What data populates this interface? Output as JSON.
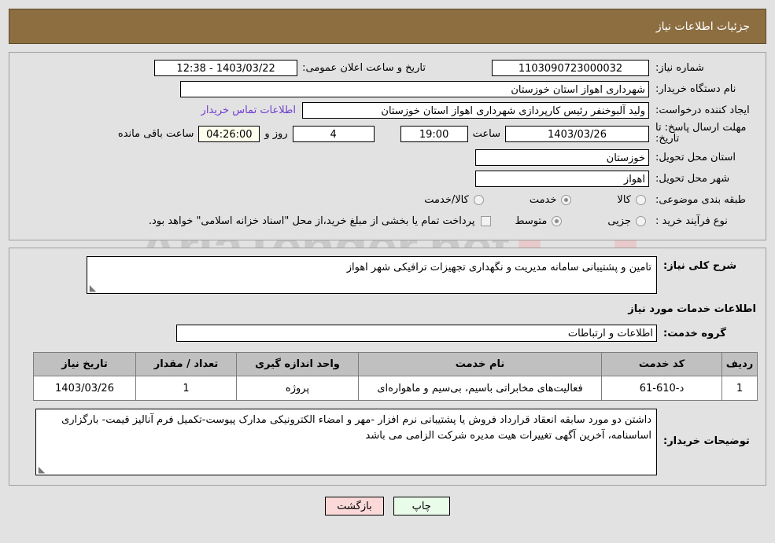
{
  "header": {
    "title": "جزئیات اطلاعات نیاز"
  },
  "form": {
    "need_number_label": "شماره نیاز:",
    "need_number_value": "1103090723000032",
    "announce_label": "تاریخ و ساعت اعلان عمومی:",
    "announce_value": "1403/03/22 - 12:38",
    "buyer_org_label": "نام دستگاه خریدار:",
    "buyer_org_value": "شهرداری اهواز استان خوزستان",
    "creator_label": "ایجاد کننده درخواست:",
    "creator_value": "ولید آلبوخنفر رئیس کارپردازی شهرداری اهواز استان خوزستان",
    "contact_link": "اطلاعات تماس خریدار",
    "deadline_label": "مهلت ارسال پاسخ: تا تاریخ:",
    "deadline_date": "1403/03/26",
    "hour_label": "ساعت",
    "deadline_time": "19:00",
    "days_value": "4",
    "days_label": "روز و",
    "countdown_value": "04:26:00",
    "remaining_label": "ساعت باقی مانده",
    "province_label": "استان محل تحویل:",
    "province_value": "خوزستان",
    "city_label": "شهر محل تحویل:",
    "city_value": "اهواز",
    "category_label": "طبقه بندی موضوعی:",
    "category_options": [
      {
        "label": "کالا",
        "selected": false
      },
      {
        "label": "خدمت",
        "selected": true
      },
      {
        "label": "کالا/خدمت",
        "selected": false
      }
    ],
    "process_label": "نوع فرآیند خرید :",
    "process_options": [
      {
        "label": "جزیی",
        "selected": false
      },
      {
        "label": "متوسط",
        "selected": true
      }
    ],
    "treasury_checkbox_label": "پرداخت تمام یا بخشی از مبلغ خرید،از محل \"اسناد خزانه اسلامی\" خواهد بود.",
    "treasury_checked": false
  },
  "details": {
    "summary_label": "شرح کلی نیاز:",
    "summary_value": "تامین و پشتیبانی سامانه مدیریت و نگهداری تجهیزات ترافیکی شهر اهواز",
    "services_section_title": "اطلاعات خدمات مورد نیاز",
    "service_group_label": "گروه خدمت:",
    "service_group_value": "اطلاعات و ارتباطات",
    "buyer_notes_label": "توضیحات خریدار:",
    "buyer_notes_value": "داشتن دو مورد سابقه انعقاد قرارداد فروش یا پشتیبانی نرم افزار -مهر و امضاء الکترونیکی مدارک پیوست-تکمیل فرم آنالیز قیمت- بارگزاری اساسنامه،  آخرین آگهی تغییرات هیت مدیره شرکت الزامی می باشد"
  },
  "table": {
    "columns": [
      "ردیف",
      "کد خدمت",
      "نام خدمت",
      "واحد اندازه گیری",
      "تعداد / مقدار",
      "تاریخ نیاز"
    ],
    "rows": [
      {
        "row_no": "1",
        "service_code": "د-610-61",
        "service_name": "فعالیت‌های مخابراتی باسیم، بی‌سیم و ماهواره‌ای",
        "unit": "پروژه",
        "quantity": "1",
        "need_date": "1403/03/26"
      }
    ]
  },
  "footer": {
    "print_label": "چاپ",
    "back_label": "بازگشت"
  },
  "watermark": {
    "text": "AriaTender.net"
  },
  "colors": {
    "header_brown": "#8d6e41",
    "page_bg": "#e2e2e2",
    "link_purple": "#6f3fcf",
    "countdown_bg": "#ffffee",
    "table_header_bg": "#c0c0c0",
    "print_btn_bg": "#e9fbe9",
    "back_btn_bg": "#fbd9d9"
  }
}
